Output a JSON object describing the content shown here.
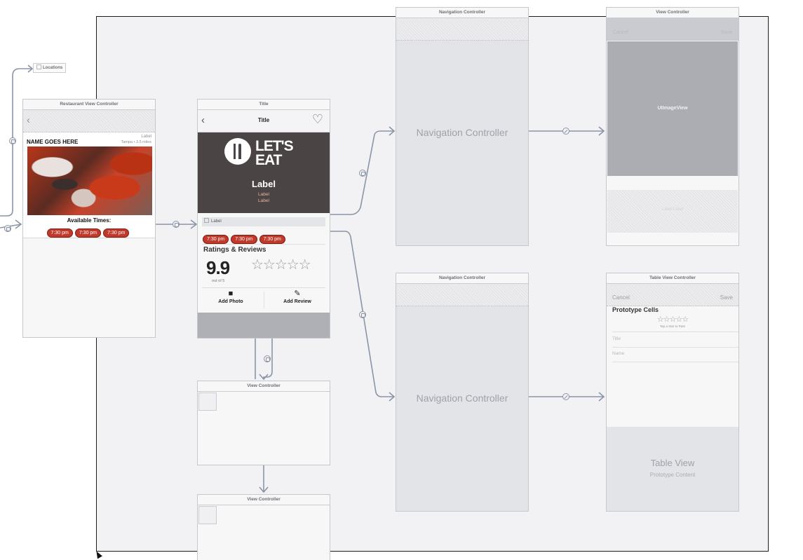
{
  "storyboard_entry": {
    "label": "Locations"
  },
  "restaurant_vc": {
    "title": "Restaurant View Controller",
    "label": "Label",
    "name": "NAME GOES HERE",
    "subtitle": "Tampa • 3.5 miles",
    "available_times": "Available Times:",
    "times": [
      "7:30 pm",
      "7:30 pm",
      "7:30 pm"
    ]
  },
  "detail_vc": {
    "scene_title": "Title",
    "nav_title": "Title",
    "logo_top": "LET'S",
    "logo_bottom": "EAT",
    "header_label": "Label",
    "header_sub1": "Label",
    "header_sub2": "Label",
    "row_label": "Label",
    "times": [
      "7:30 pm",
      "7:30 pm",
      "7:30 pm"
    ],
    "ratings_heading": "Ratings & Reviews",
    "rating_value": "9.9",
    "rating_caption": "out of 5",
    "stars": "☆☆☆☆☆",
    "add_photo": "Add Photo",
    "add_review": "Add Review"
  },
  "nav_controller_top": {
    "scene_title": "Navigation Controller",
    "center_label": "Navigation Controller"
  },
  "nav_controller_bottom": {
    "scene_title": "Navigation Controller",
    "center_label": "Navigation Controller"
  },
  "photo_vc": {
    "scene_title": "View Controller",
    "cancel": "Cancel",
    "save": "Save",
    "image_label": "UIImageView",
    "lower_label": "Label Label"
  },
  "review_tvc": {
    "scene_title": "Table View Controller",
    "cancel": "Cancel",
    "save": "Save",
    "prototype_cells": "Prototype Cells",
    "stars": "☆☆☆☆☆",
    "tap_caption": "Tap a Star to Rate",
    "title_field": "Title",
    "name_field": "Name",
    "table_view": "Table View",
    "prototype_content": "Prototype Content"
  },
  "view_controller_a": {
    "scene_title": "View Controller"
  },
  "view_controller_b": {
    "scene_title": "View Controller"
  },
  "colors": {
    "canvas": "#f2f2f4",
    "accent_red": "#c0392b",
    "header_dark": "#4a4544",
    "wire": "#8a95a5"
  }
}
